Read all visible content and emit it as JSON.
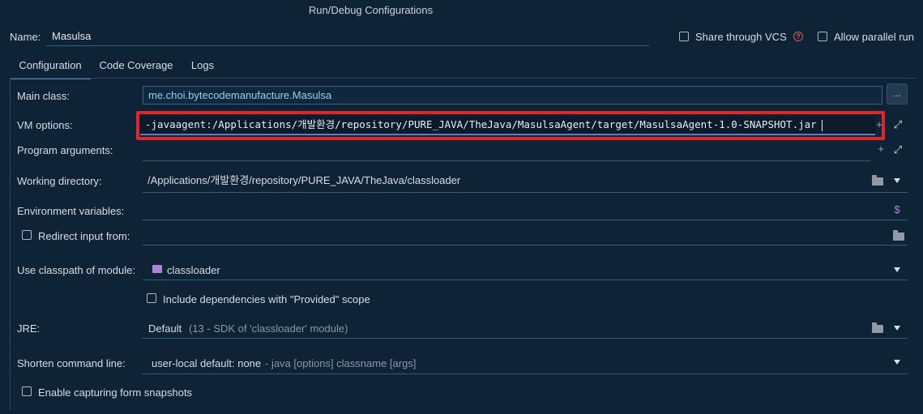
{
  "window": {
    "title": "Run/Debug Configurations"
  },
  "header": {
    "name_label": "Name:",
    "name_value": "Masulsa",
    "share_vcs_label": "Share through VCS",
    "allow_parallel_label": "Allow parallel run"
  },
  "tabs": [
    {
      "label": "Configuration",
      "active": true
    },
    {
      "label": "Code Coverage",
      "active": false
    },
    {
      "label": "Logs",
      "active": false
    }
  ],
  "form": {
    "main_class": {
      "label": "Main class:",
      "value": "me.choi.bytecodemanufacture.Masulsa",
      "browse": "..."
    },
    "vm_options": {
      "label": "VM options:",
      "value": "-javaagent:/Applications/개발환경/repository/PURE_JAVA/TheJava/MasulsaAgent/target/MasulsaAgent-1.0-SNAPSHOT.jar"
    },
    "program_arguments": {
      "label": "Program arguments:",
      "value": ""
    },
    "working_directory": {
      "label": "Working directory:",
      "value": "/Applications/개발환경/repository/PURE_JAVA/TheJava/classloader"
    },
    "environment_variables": {
      "label": "Environment variables:",
      "value": ""
    },
    "redirect_input": {
      "label": "Redirect input from:",
      "checked": false
    },
    "classpath_module": {
      "label": "Use classpath of module:",
      "value": "classloader"
    },
    "include_dependencies": {
      "label": "Include dependencies with \"Provided\" scope",
      "checked": false
    },
    "jre": {
      "label": "JRE:",
      "value": "Default",
      "hint": "(13 - SDK of 'classloader' module)"
    },
    "shorten_command_line": {
      "label": "Shorten command line:",
      "value": "user-local default: none",
      "hint": "- java [options] classname [args]"
    },
    "enable_snapshots": {
      "label": "Enable capturing form snapshots",
      "checked": false
    }
  },
  "icons": {
    "expand": "⤢",
    "plus": "+",
    "dollar": "$"
  },
  "colors": {
    "background": "#0f2336",
    "accent": "#4a86c7",
    "highlight_box": "#e0262b",
    "main_class_text": "#8fd3e8"
  }
}
